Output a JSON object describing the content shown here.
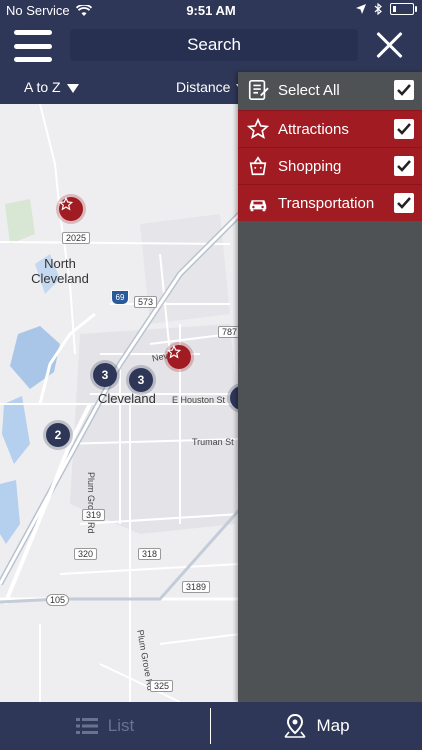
{
  "status": {
    "carrier": "No Service",
    "time": "9:51 AM"
  },
  "header": {
    "search_label": "Search"
  },
  "sort": {
    "alpha_label": "A to Z",
    "distance_label": "Distance"
  },
  "map": {
    "labels": {
      "north_cleveland": "North\nCleveland",
      "cleveland": "Cleveland",
      "e_houston": "E Houston St",
      "truman": "Truman St",
      "plum_grove_1": "Plum Grove Rd",
      "plum_grove_2": "Plum Grove Rd",
      "nev": "Nev"
    },
    "shields": {
      "r2025": "2025",
      "r573": "573",
      "r787": "787",
      "r319": "319",
      "r320": "320",
      "r318": "318",
      "r3189": "3189",
      "r105": "105",
      "r325": "325",
      "i69": "69"
    },
    "clusters": {
      "a": "3",
      "b": "3",
      "c": "2"
    }
  },
  "filters": {
    "select_all": "Select All",
    "items": [
      {
        "label": "Attractions",
        "icon": "star-outline-icon"
      },
      {
        "label": "Shopping",
        "icon": "shopping-bag-icon"
      },
      {
        "label": "Transportation",
        "icon": "car-icon"
      }
    ]
  },
  "tabs": {
    "list": "List",
    "map": "Map"
  },
  "colors": {
    "nav": "#2f3758",
    "accent_red": "#a01b22",
    "panel": "#4e5254"
  }
}
